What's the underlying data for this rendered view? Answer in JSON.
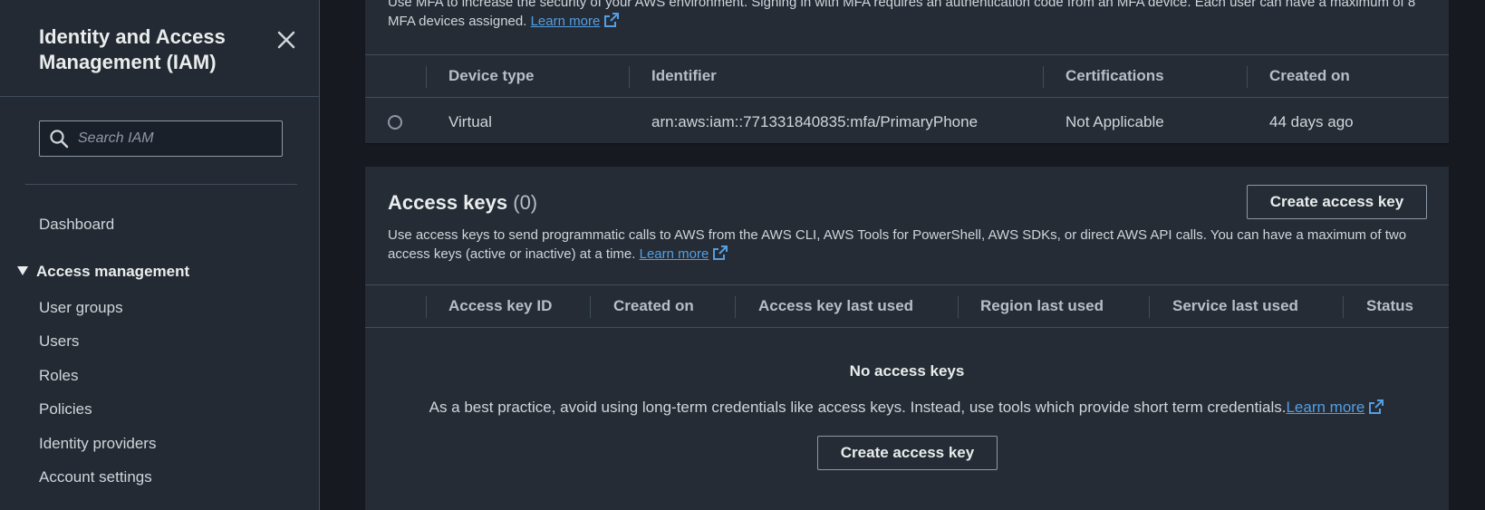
{
  "sidebar": {
    "title": "Identity and Access Management (IAM)",
    "search_placeholder": "Search IAM",
    "dashboard": "Dashboard",
    "section": "Access management",
    "items": [
      "User groups",
      "Users",
      "Roles",
      "Policies",
      "Identity providers",
      "Account settings"
    ]
  },
  "mfa": {
    "description": "Use MFA to increase the security of your AWS environment. Signing in with MFA requires an authentication code from an MFA device. Each user can have a maximum of 8 MFA devices assigned.",
    "learn_more": "Learn more",
    "columns": [
      "Device type",
      "Identifier",
      "Certifications",
      "Created on"
    ],
    "row": {
      "device_type": "Virtual",
      "identifier": "arn:aws:iam::771331840835:mfa/PrimaryPhone",
      "certifications": "Not Applicable",
      "created_on": "44 days ago"
    }
  },
  "access_keys": {
    "title": "Access keys",
    "count": "(0)",
    "create_button": "Create access key",
    "description": "Use access keys to send programmatic calls to AWS from the AWS CLI, AWS Tools for PowerShell, AWS SDKs, or direct AWS API calls. You can have a maximum of two access keys (active or inactive) at a time.",
    "learn_more": "Learn more",
    "columns": [
      "Access key ID",
      "Created on",
      "Access key last used",
      "Region last used",
      "Service last used",
      "Status"
    ],
    "empty_title": "No access keys",
    "empty_text": "As a best practice, avoid using long-term credentials like access keys. Instead, use tools which provide short term credentials.",
    "empty_learn_more": "Learn more",
    "empty_button": "Create access key"
  },
  "colors": {
    "link": "#539fe5",
    "border": "#414d5c",
    "panel": "#252c35"
  },
  "icons": [
    "close-icon",
    "search-icon",
    "caret-down-icon",
    "external-link-icon"
  ]
}
